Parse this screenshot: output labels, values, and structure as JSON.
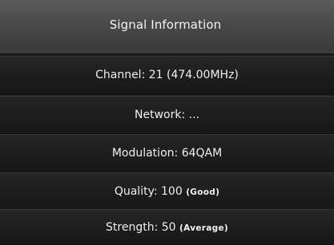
{
  "header": {
    "title": "Signal Information"
  },
  "rows": [
    {
      "label": "Channel:",
      "value": "21 (474.00MHz)"
    },
    {
      "label": "Network:",
      "value": "..."
    },
    {
      "label": "Modulation:",
      "value": "64QAM"
    },
    {
      "label": "Quality:",
      "value": "100",
      "tag": "(Good)"
    },
    {
      "label": "Strength:",
      "value": "50",
      "tag": "(Average)"
    }
  ]
}
